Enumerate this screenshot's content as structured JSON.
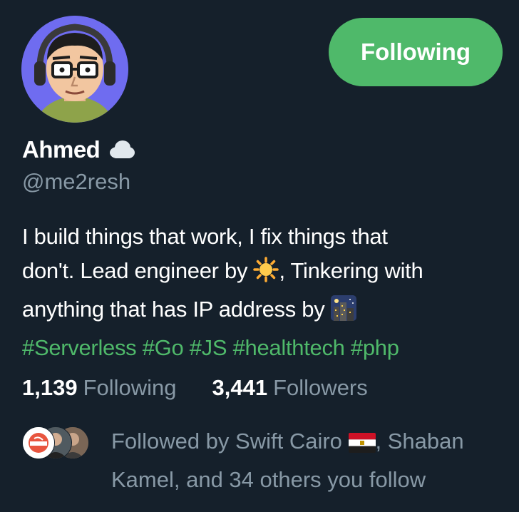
{
  "profile": {
    "display_name": "Ahmed",
    "name_icon": "cloud-icon",
    "handle": "@me2resh",
    "follow_button_label": "Following",
    "accent_color": "#4fb96a",
    "background_color": "#15202b"
  },
  "bio": {
    "line1": "I build things that work, I fix things that",
    "line2_before": "don't. Lead engineer by ",
    "line2_after": ", Tinkering with",
    "line3_before": "anything that has IP address by ",
    "emoji_day": "sun-emoji",
    "emoji_night": "night-city-emoji",
    "hashtags": [
      "#Serverless",
      "#Go",
      "#JS",
      "#healthtech",
      "#php"
    ]
  },
  "stats": {
    "following_count": "1,139",
    "following_label": "Following",
    "followers_count": "3,441",
    "followers_label": "Followers"
  },
  "followed_by": {
    "line1_before": "Followed by Swift Cairo ",
    "flag": "egypt-flag-emoji",
    "line1_after": ", Shaban",
    "line2": "Kamel, and 34 others you follow",
    "avatars": [
      "swift-cairo-avatar",
      "shaban-kamel-avatar",
      "follower-avatar"
    ]
  }
}
